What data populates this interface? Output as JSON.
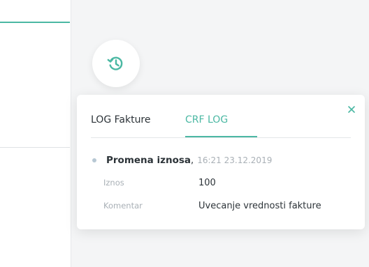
{
  "popover": {
    "tabs": [
      {
        "label": "LOG Fakture",
        "active": false
      },
      {
        "label": "CRF LOG",
        "active": true
      }
    ],
    "close_icon": "close-icon",
    "entries": [
      {
        "title": "Promena iznosa",
        "separator": ",",
        "timestamp": "16:21 23.12.2019",
        "fields": [
          {
            "label": "Iznos",
            "value": "100"
          },
          {
            "label": "Komentar",
            "value": "Uvecanje vrednosti fakture"
          }
        ]
      }
    ]
  },
  "history_button": {
    "icon": "history-icon"
  },
  "colors": {
    "accent": "#4bb8a3",
    "text": "#2c3338",
    "muted": "#a9b0b6",
    "background": "#f4f5f6"
  }
}
